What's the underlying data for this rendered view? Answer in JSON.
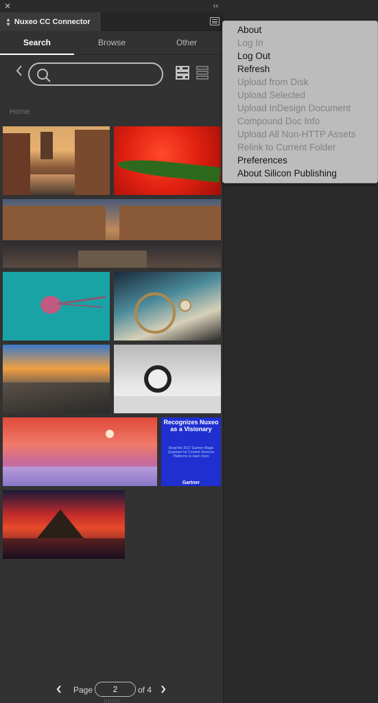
{
  "panel": {
    "title": "Nuxeo CC Connector",
    "close_glyph": "✕",
    "collapse_glyph": "‹‹",
    "menu_icon": "hamburger-icon"
  },
  "tabs": [
    {
      "label": "Search",
      "active": true
    },
    {
      "label": "Browse",
      "active": false
    },
    {
      "label": "Other",
      "active": false
    }
  ],
  "search": {
    "value": "",
    "placeholder": ""
  },
  "breadcrumb": "Home",
  "thumbnails": [
    "canal-warehouses-sunset",
    "red-flower-water-drops",
    "bridge-warehouses-night",
    "jellyfish-turquoise-sea",
    "vintage-car-dashboard",
    "mountain-sunset-clouds",
    "alarm-clock-desk",
    "pink-winter-sunset-field",
    "nuxeo-gartner-ad",
    "mountain-red-sunset-reflection"
  ],
  "ad": {
    "headline": "Recognizes Nuxeo as a Visionary",
    "body": "Read the 2017 Gartner Magic Quadrant for Content Services Platforms to learn more",
    "footer": "Gartner"
  },
  "pager": {
    "page_label": "Page",
    "current": "2",
    "of_label": "of 4"
  },
  "menu": [
    {
      "label": "About",
      "enabled": true
    },
    {
      "label": "Log In",
      "enabled": false
    },
    {
      "label": "Log Out",
      "enabled": true
    },
    {
      "label": "Refresh",
      "enabled": true
    },
    {
      "label": "Upload from Disk",
      "enabled": false
    },
    {
      "label": "Upload Selected",
      "enabled": false
    },
    {
      "label": "Upload InDesign Document",
      "enabled": false
    },
    {
      "label": "Compound Doc Info",
      "enabled": false
    },
    {
      "label": "Upload All Non-HTTP Assets",
      "enabled": false
    },
    {
      "label": "Relink to Current Folder",
      "enabled": false
    },
    {
      "label": "Preferences",
      "enabled": true
    },
    {
      "label": "About Silicon Publishing",
      "enabled": true
    }
  ]
}
